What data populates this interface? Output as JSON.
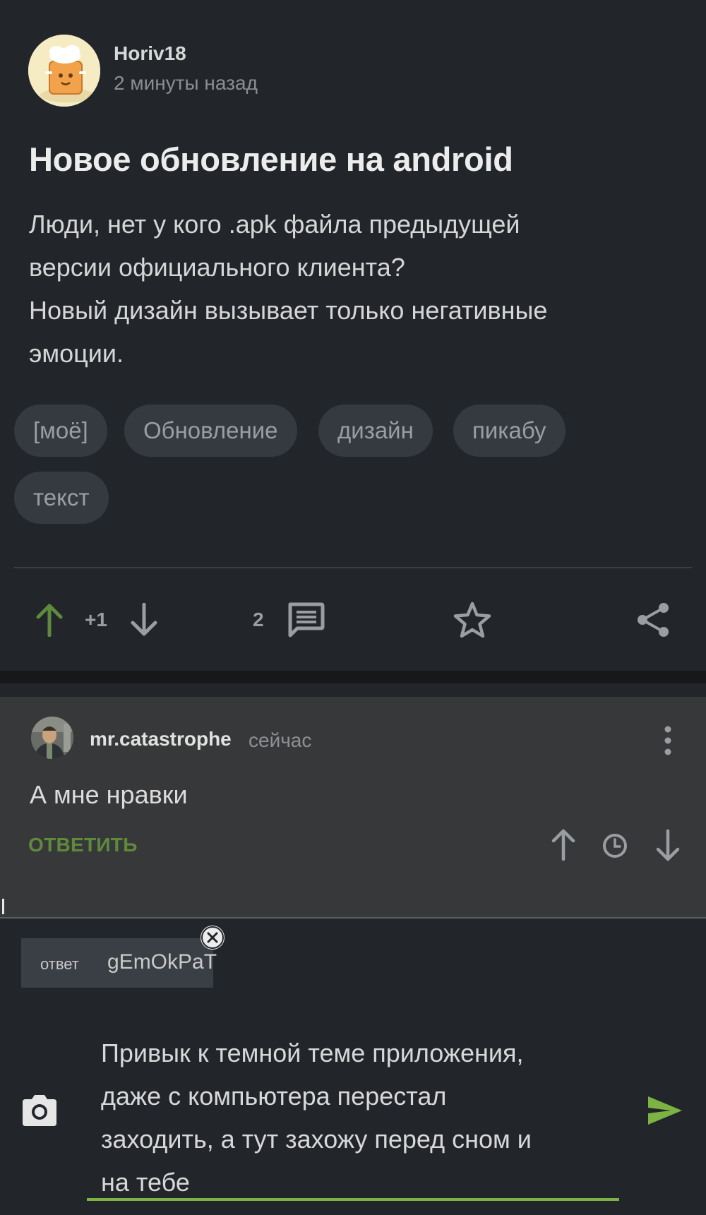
{
  "post": {
    "author": "Horiv18",
    "time": "2 минуты назад",
    "title": "Новое обновление на android",
    "body": "Люди, нет у кого .apk файла предыдущей\nверсии официального клиента?\nНовый дизайн вызывает только негативные\nэмоции.",
    "tags": [
      "[моё]",
      "Обновление",
      "дизайн",
      "пикабу",
      "текст"
    ],
    "rating": "+1",
    "comments_count": "2"
  },
  "comment": {
    "author": "mr.catastrophe",
    "time": "сейчас",
    "text": "А мне нравки",
    "reply_label": "ОТВЕТИТЬ"
  },
  "composer": {
    "reply_prefix": "ответ",
    "reply_user": "gEmOkPaT",
    "text": "Привык к темной теме приложения,\nдаже с компьютера перестал\nзаходить, а тут захожу перед сном и\nна тебе"
  },
  "colors": {
    "background": "#22262b",
    "comment_background": "#373839",
    "accent_green": "#7cb342",
    "upvote_green": "#5f8a3c"
  },
  "icons": {
    "upvote": "arrow-up-icon",
    "downvote": "arrow-down-icon",
    "comments": "comment-icon",
    "save": "star-icon",
    "share": "share-icon",
    "more": "more-vertical-icon",
    "history": "clock-icon",
    "camera": "camera-icon",
    "send": "send-icon",
    "close": "close-icon"
  }
}
